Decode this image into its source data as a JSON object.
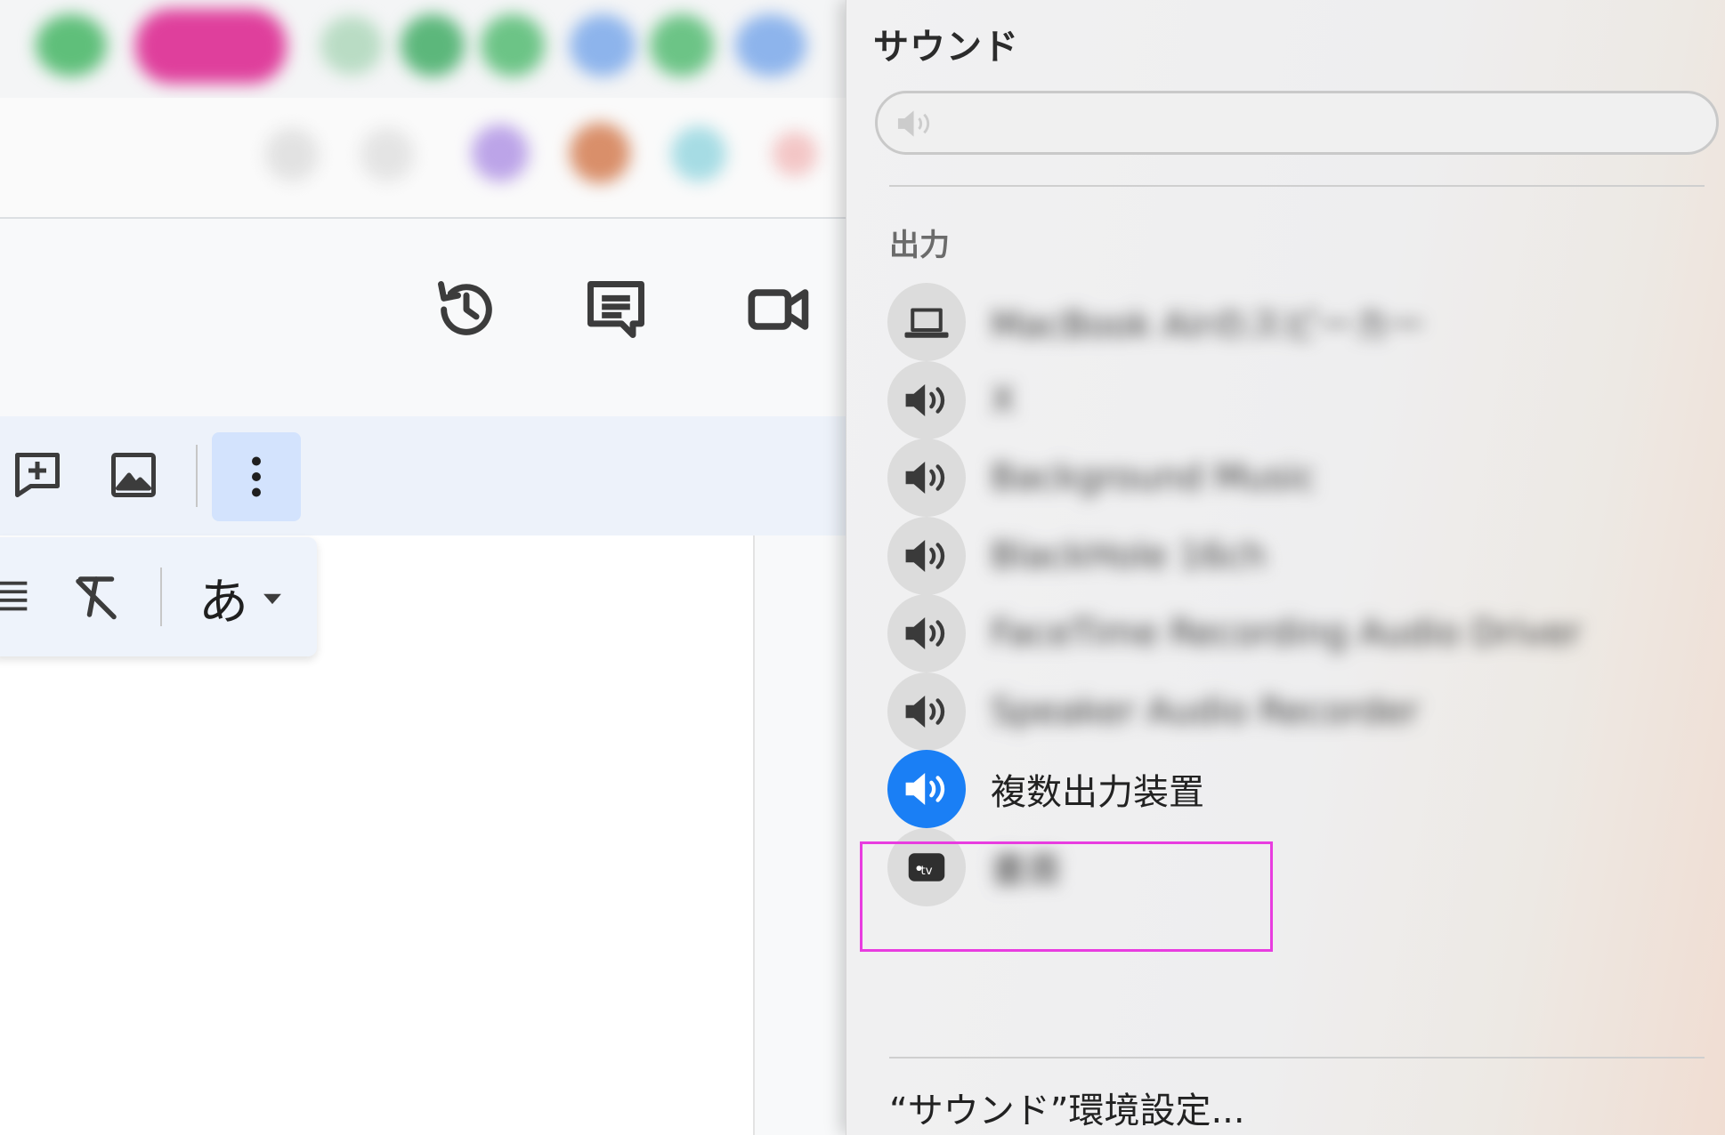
{
  "sound_menu": {
    "title": "サウンド",
    "volume": {
      "level": 0.0
    },
    "output_section_label": "出力",
    "devices": [
      {
        "label": "MacBook Airのスピーカー",
        "icon": "laptop-icon",
        "blurred": true,
        "selected": false
      },
      {
        "label": "X",
        "icon": "speaker-icon",
        "blurred": true,
        "selected": false
      },
      {
        "label": "Background Music",
        "icon": "speaker-icon",
        "blurred": true,
        "selected": false
      },
      {
        "label": "BlackHole 16ch",
        "icon": "speaker-icon",
        "blurred": true,
        "selected": false
      },
      {
        "label": "FaceTime Recording Audio Driver",
        "icon": "speaker-icon",
        "blurred": true,
        "selected": false
      },
      {
        "label": "Speaker Audio Recorder",
        "icon": "speaker-icon",
        "blurred": true,
        "selected": false
      },
      {
        "label": "複数出力装置",
        "icon": "speaker-icon",
        "blurred": false,
        "selected": true
      },
      {
        "label": "書斎",
        "icon": "apple-tv-icon",
        "blurred": true,
        "selected": false
      }
    ],
    "preferences_link": "“サウンド”環境設定..."
  },
  "app": {
    "ime_mode": "あ"
  },
  "colors": {
    "accent_blue": "#1a7ff5",
    "highlight_magenta": "#e83ce0",
    "toolbar_bg": "#edf2fa"
  }
}
